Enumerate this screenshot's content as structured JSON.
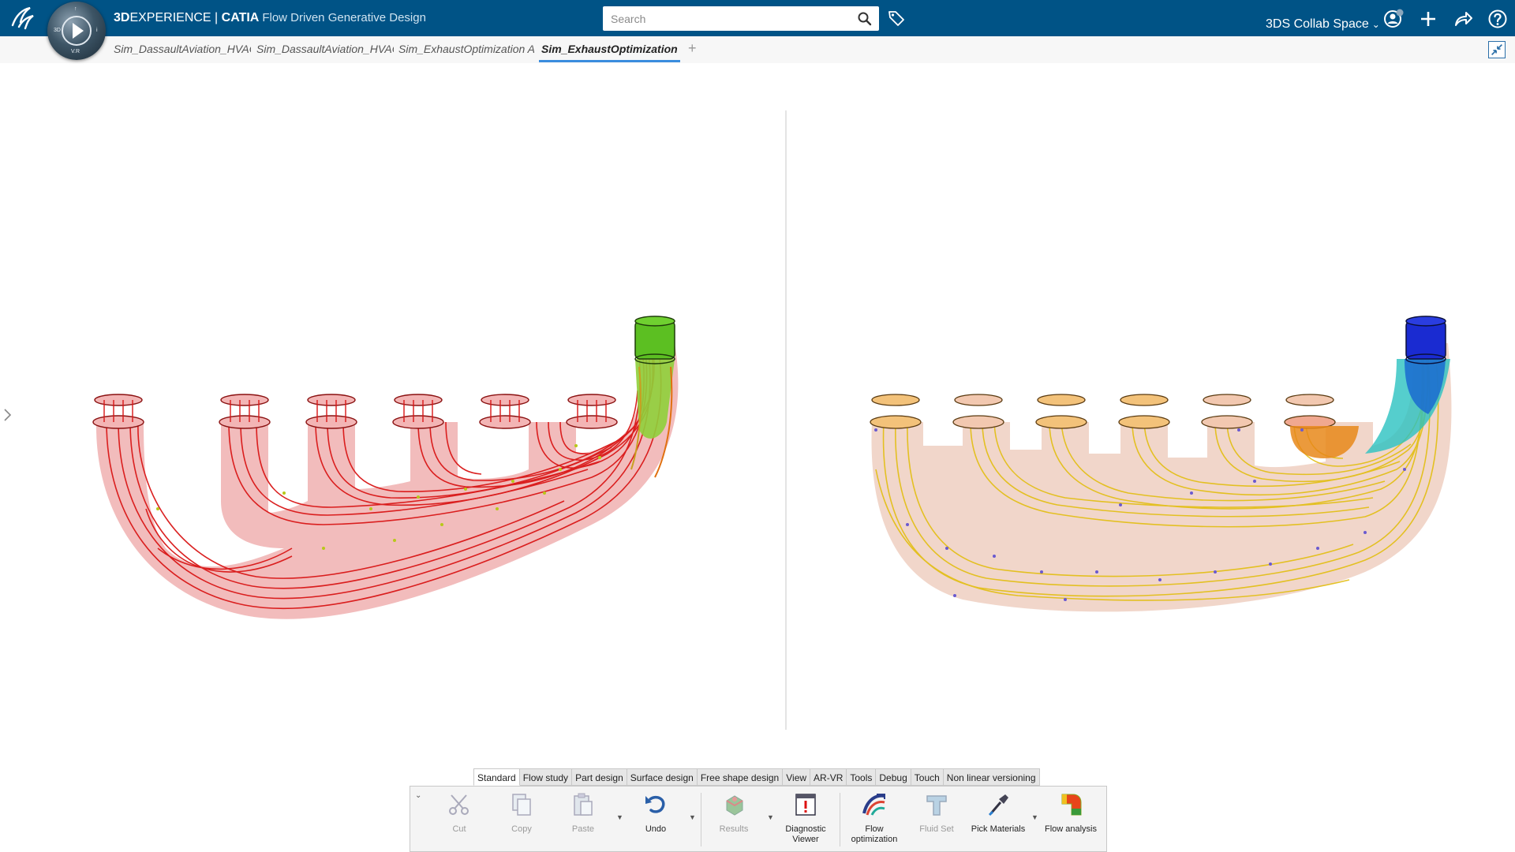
{
  "header": {
    "brand_bold": "3D",
    "brand_rest": "EXPERIENCE",
    "separator": " | ",
    "product": "CATIA",
    "app_name": "Flow Driven Generative Design",
    "compass_labels": {
      "top": "↑",
      "left": "3D",
      "right": "i",
      "bottom": "V.R"
    },
    "search_placeholder": "Search",
    "collab_space": "3DS Collab Space",
    "notification_count": "0",
    "icons": [
      "ds-logo-icon",
      "compass-icon",
      "search-icon",
      "tag-icon",
      "user-icon",
      "plus-icon",
      "share-icon",
      "help-icon"
    ]
  },
  "tabs": [
    {
      "label": "Sim_DassaultAviation_HVAC",
      "active": false
    },
    {
      "label": "Sim_DassaultAviation_HVAC",
      "active": false
    },
    {
      "label": "Sim_ExhaustOptimization A",
      "active": false
    },
    {
      "label": "Sim_ExhaustOptimization",
      "active": true
    }
  ],
  "tab_add_label": "+",
  "viewport": {
    "left_model": {
      "description_colors": [
        "#dd1a1a",
        "#f0a0a0",
        "#5fc11e"
      ]
    },
    "right_model": {
      "description_colors": [
        "#e8c21a",
        "#f0d0c8",
        "#1a2bd1",
        "#1ac2c9"
      ]
    }
  },
  "action_bar": {
    "tabs": [
      "Standard",
      "Flow study",
      "Part design",
      "Surface design",
      "Free shape design",
      "View",
      "AR-VR",
      "Tools",
      "Debug",
      "Touch",
      "Non linear versioning"
    ],
    "active_tab": "Standard",
    "tools": [
      {
        "label": "Cut",
        "icon": "scissors-icon",
        "enabled": false
      },
      {
        "label": "Copy",
        "icon": "copy-icon",
        "enabled": false
      },
      {
        "label": "Paste",
        "icon": "paste-icon",
        "enabled": false
      },
      {
        "label": "Undo",
        "icon": "undo-icon",
        "enabled": true
      },
      {
        "label": "Results",
        "icon": "results-icon",
        "enabled": false
      },
      {
        "label": "Diagnostic Viewer",
        "icon": "diagnostic-icon",
        "enabled": true
      },
      {
        "label": "Flow optimization",
        "icon": "flow-optimization-icon",
        "enabled": true
      },
      {
        "label": "Fluid Set",
        "icon": "fluid-set-icon",
        "enabled": false
      },
      {
        "label": "Pick Materials",
        "icon": "pick-materials-icon",
        "enabled": true
      },
      {
        "label": "Flow analysis",
        "icon": "flow-analysis-icon",
        "enabled": true
      }
    ]
  }
}
